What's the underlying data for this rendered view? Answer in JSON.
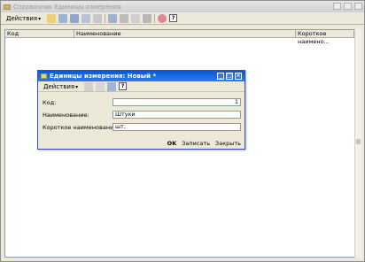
{
  "main": {
    "title": "Справочник Единицы измерения",
    "toolbar": {
      "menu_label": "Действия"
    },
    "list": {
      "columns": [
        "Код",
        "Наименование",
        "Короткое наимено..."
      ]
    }
  },
  "dialog": {
    "title": "Единицы измерения: Новый *",
    "toolbar": {
      "menu_label": "Действия"
    },
    "fields": {
      "code_label": "Код:",
      "code_value": "1",
      "name_label": "Наименование:",
      "name_value": "Штуки",
      "short_label": "Короткое наименование:",
      "short_value": "шт."
    },
    "buttons": {
      "ok": "OK",
      "save": "Записать",
      "close": "Закрыть"
    }
  },
  "icons": {
    "help": "?"
  }
}
